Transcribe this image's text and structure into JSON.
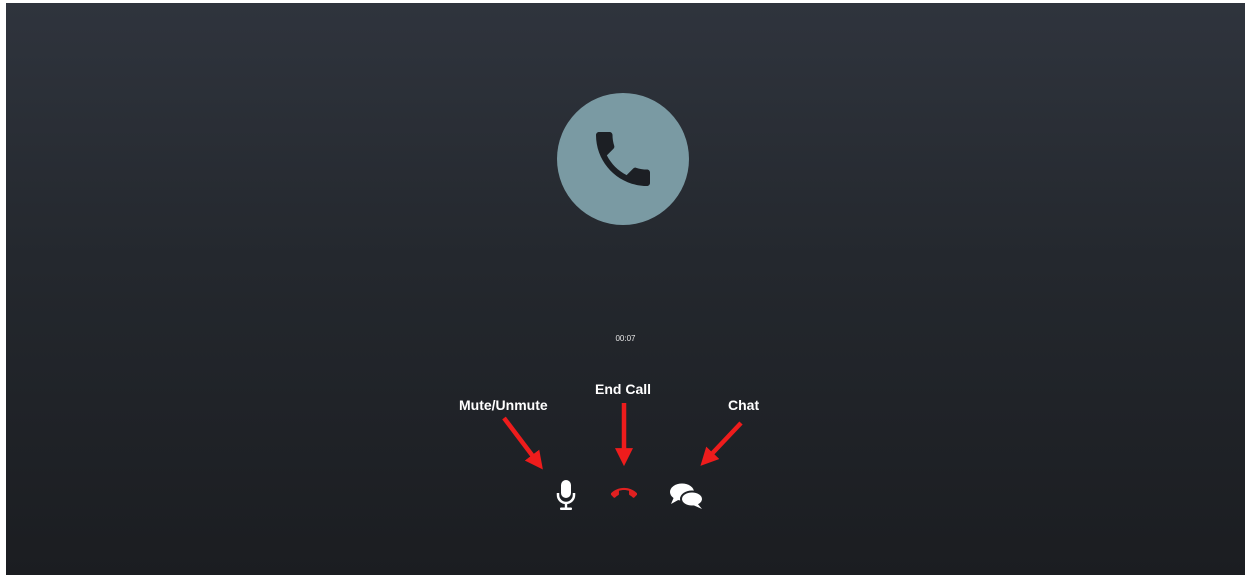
{
  "call": {
    "timer": "00:07",
    "avatar_icon": "phone-icon"
  },
  "controls": {
    "mute": {
      "label": "Mute/Unmute",
      "icon": "microphone-icon"
    },
    "end_call": {
      "label": "End Call",
      "icon": "hangup-icon"
    },
    "chat": {
      "label": "Chat",
      "icon": "chat-bubbles-icon"
    }
  },
  "colors": {
    "avatar_bg": "#7a9aa3",
    "end_call": "#e02020",
    "annotation_arrow": "#ee1c1c",
    "background_top": "#2f343d",
    "background_bottom": "#1b1d21"
  }
}
